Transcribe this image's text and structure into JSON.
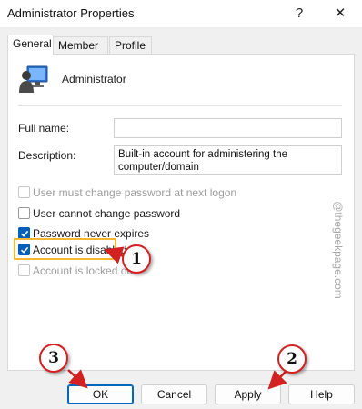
{
  "window": {
    "title": "Administrator Properties",
    "help_glyph": "?",
    "close_glyph": "✕"
  },
  "tabs": [
    {
      "label": "General",
      "active": true
    },
    {
      "label": "Member Of",
      "active": false
    },
    {
      "label": "Profile",
      "active": false
    }
  ],
  "user": {
    "icon": "user-monitor-icon",
    "name": "Administrator"
  },
  "fields": {
    "full_name_label": "Full name:",
    "full_name_value": "",
    "description_label": "Description:",
    "description_line1": "Built-in account for administering the",
    "description_line2": "computer/domain"
  },
  "checkboxes": [
    {
      "label": "User must change password at next logon",
      "checked": false,
      "disabled": true
    },
    {
      "label": "User cannot change password",
      "checked": false,
      "disabled": false
    },
    {
      "label": "Password never expires",
      "checked": true,
      "disabled": false
    },
    {
      "label": "Account is disabled",
      "checked": true,
      "disabled": false
    },
    {
      "label": "Account is locked out",
      "checked": false,
      "disabled": true
    }
  ],
  "buttons": {
    "ok": "OK",
    "cancel": "Cancel",
    "apply": "Apply",
    "help": "Help"
  },
  "annotations": {
    "step1": "1",
    "step2": "2",
    "step3": "3",
    "highlight_color": "#f5b731",
    "badge_border_color": "#d32020",
    "arrow_color": "#d32020"
  },
  "watermark": "@thegeekpage.com",
  "colors": {
    "accent": "#005fb8"
  }
}
